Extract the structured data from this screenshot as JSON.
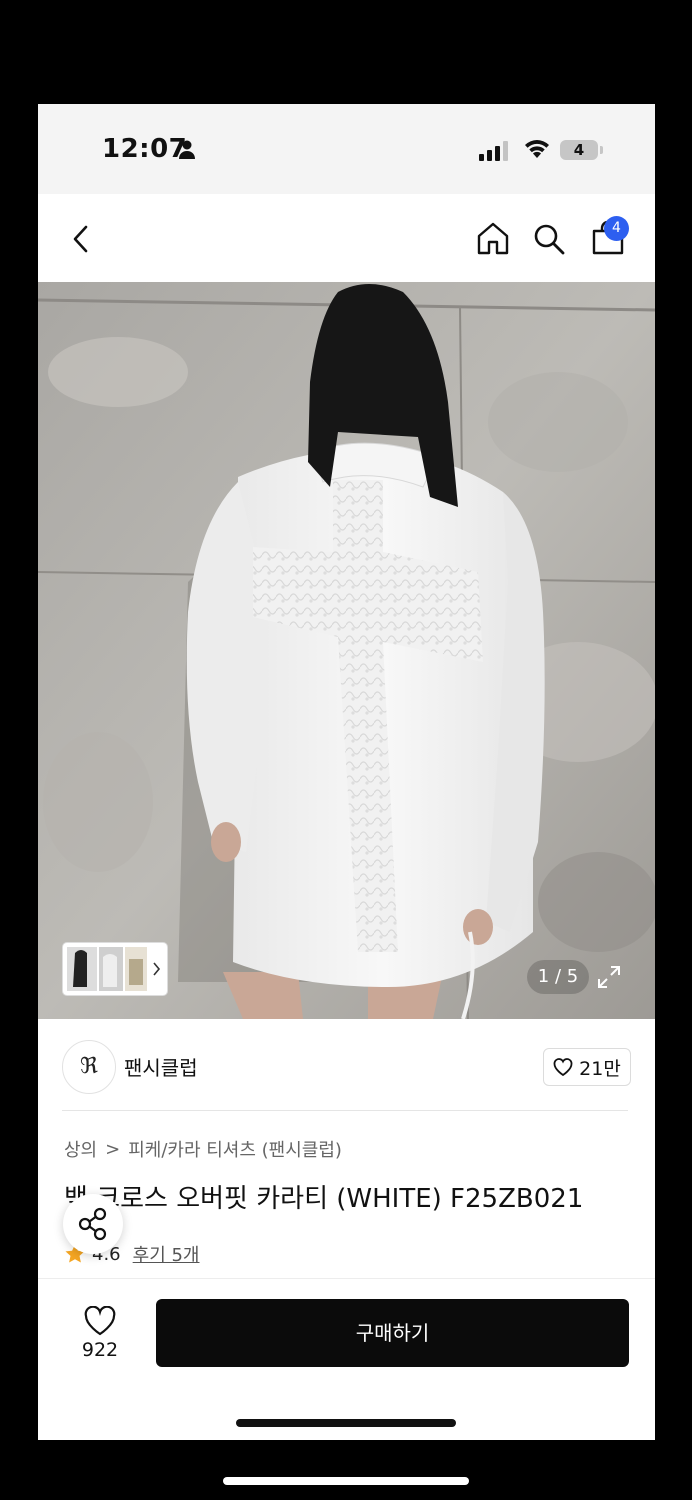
{
  "status_bar": {
    "time": "12:07",
    "battery": "4"
  },
  "nav": {
    "cart_count": "4"
  },
  "gallery": {
    "counter": "1 / 5"
  },
  "brand": {
    "logo_text": "ℜ",
    "name": "팬시클럽",
    "likes": "21만"
  },
  "breadcrumb": {
    "category": "상의",
    "separator": ">",
    "subcategory": "피케/카라 티셔츠 (팬시클럽)"
  },
  "product": {
    "title": "백 크로스 오버핏 카라티 (WHITE) F25ZB021",
    "rating": "4.6",
    "reviews": "후기 5개"
  },
  "bottom_bar": {
    "wish_count": "922",
    "buy_label": "구매하기"
  },
  "colors": {
    "accent": "#2d5ff0",
    "buy_button": "#0b0b0b",
    "star": "#f5a623"
  }
}
